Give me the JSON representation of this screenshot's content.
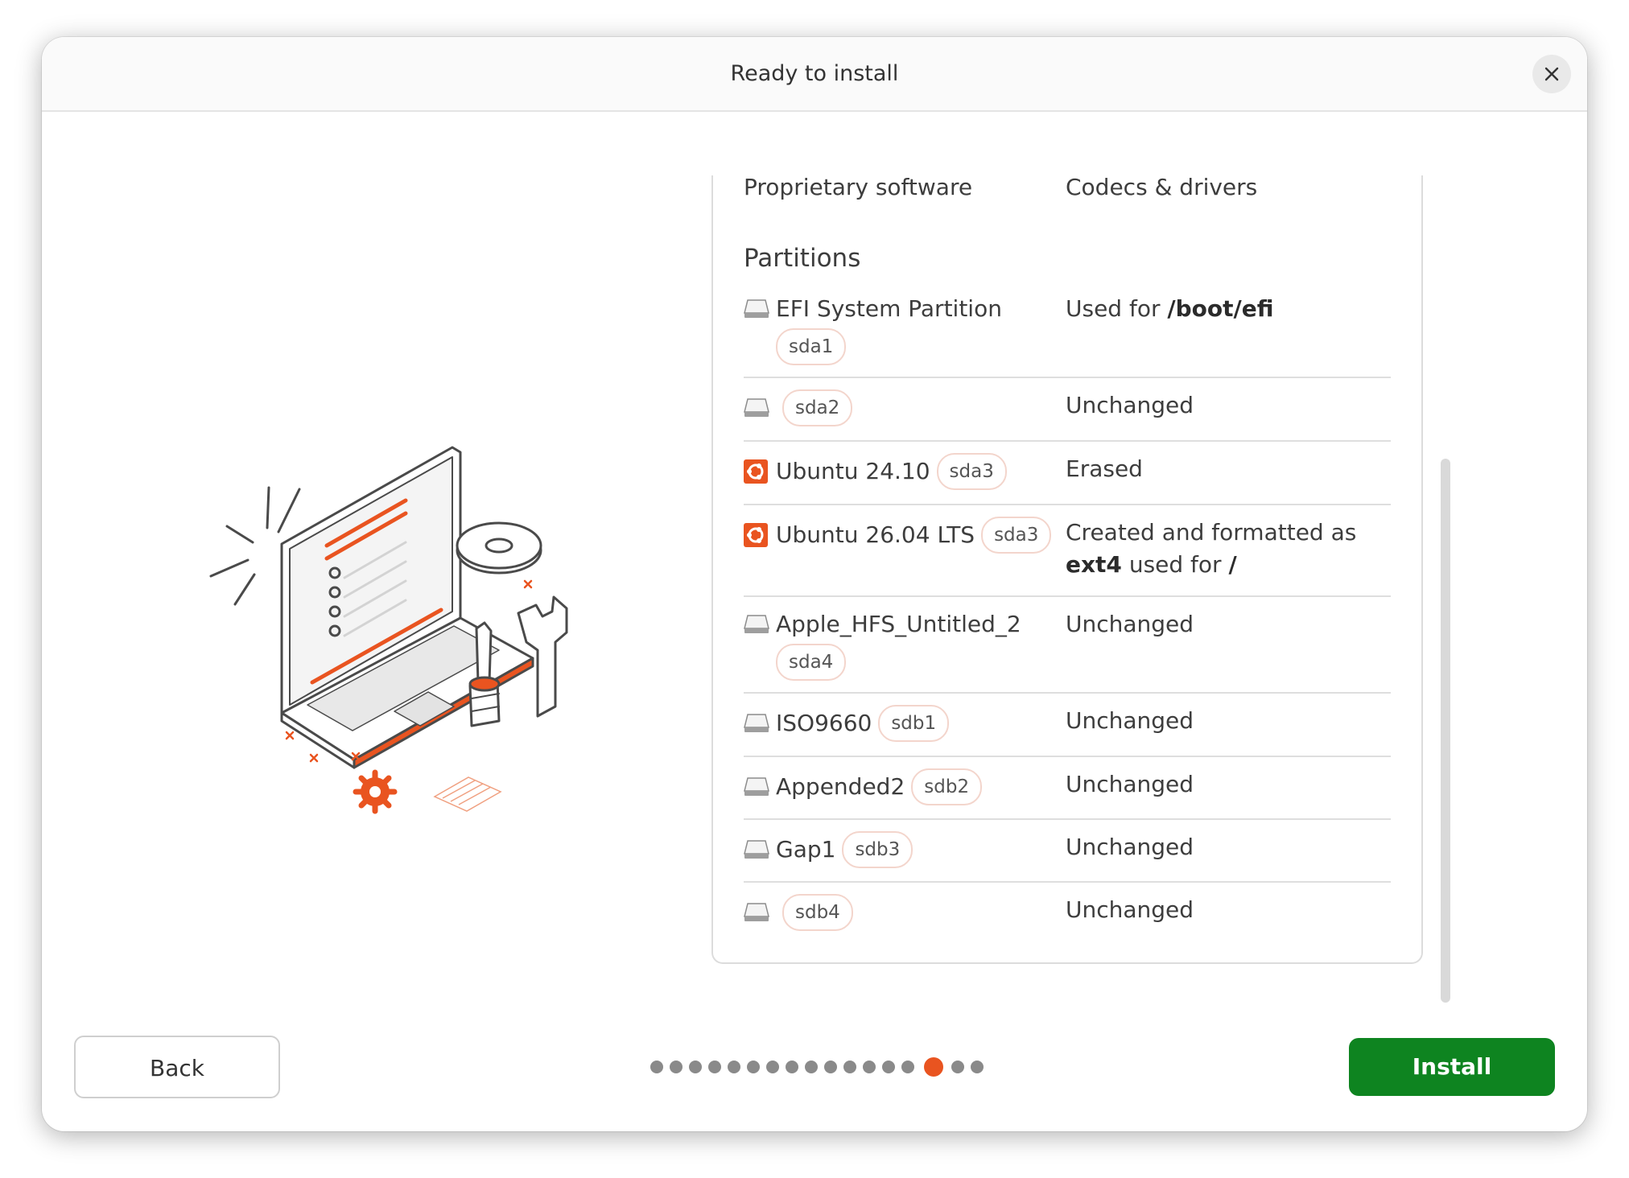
{
  "window": {
    "title": "Ready to install"
  },
  "summary": {
    "top_row": {
      "label": "Proprietary software",
      "value": "Codecs & drivers"
    },
    "section_title": "Partitions",
    "partitions": [
      {
        "name": "EFI System Partition",
        "device": "sda1",
        "icon": "disk-icon",
        "status_prefix": "Used for ",
        "status_bold": "/boot/efi"
      },
      {
        "name": "",
        "device": "sda2",
        "icon": "disk-icon",
        "status": "Unchanged"
      },
      {
        "name": "Ubuntu 24.10",
        "device": "sda3",
        "icon": "ubuntu-logo-icon",
        "status": "Erased"
      },
      {
        "name": "Ubuntu 26.04 LTS",
        "device": "sda3",
        "icon": "ubuntu-logo-icon",
        "status_prefix": "Created and formatted as ",
        "status_bold": "ext4",
        "status_mid": " used for ",
        "status_bold2": "/"
      },
      {
        "name": "Apple_HFS_Untitled_2",
        "device": "sda4",
        "icon": "disk-icon",
        "status": "Unchanged"
      },
      {
        "name": "ISO9660",
        "device": "sdb1",
        "icon": "disk-icon",
        "status": "Unchanged"
      },
      {
        "name": "Appended2",
        "device": "sdb2",
        "icon": "disk-icon",
        "status": "Unchanged"
      },
      {
        "name": "Gap1",
        "device": "sdb3",
        "icon": "disk-icon",
        "status": "Unchanged"
      },
      {
        "name": "",
        "device": "sdb4",
        "icon": "disk-icon",
        "status": "Unchanged"
      }
    ]
  },
  "footer": {
    "back_label": "Back",
    "install_label": "Install",
    "progress": {
      "total_steps": 17,
      "current_step": 15
    }
  },
  "colors": {
    "accent": "#e95420",
    "install_green": "#0e8420"
  }
}
